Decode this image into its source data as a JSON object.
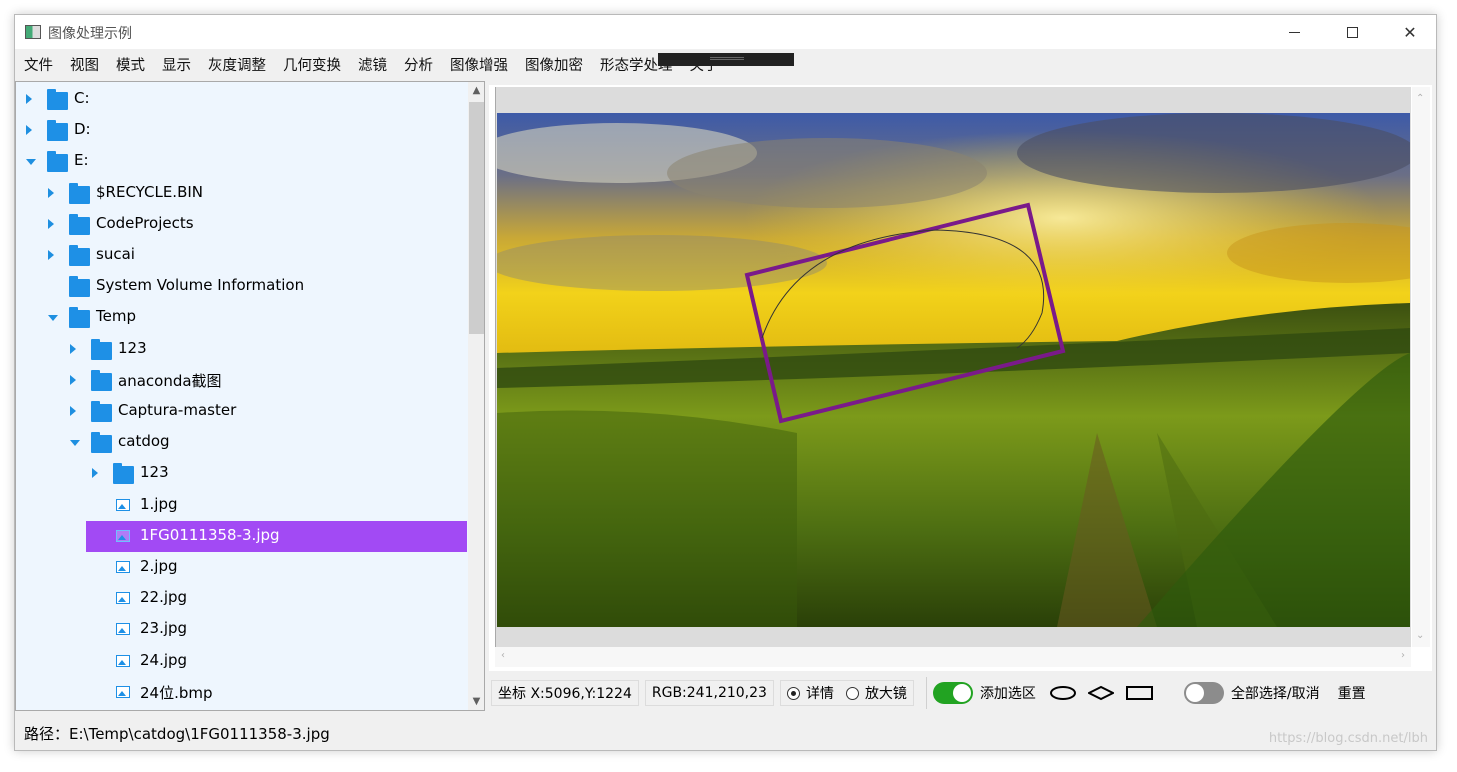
{
  "window": {
    "title": "图像处理示例",
    "controls": {
      "minimize": "—",
      "maximize": "☐",
      "close": "✕"
    }
  },
  "menu": {
    "items": [
      "文件",
      "视图",
      "模式",
      "显示",
      "灰度调整",
      "几何变换",
      "滤镜",
      "分析",
      "图像增强",
      "图像加密",
      "形态学处理",
      "关于"
    ]
  },
  "tree": {
    "rows": [
      {
        "label": "C:",
        "type": "folder",
        "expander": "collapsed"
      },
      {
        "label": "D:",
        "type": "folder",
        "expander": "collapsed"
      },
      {
        "label": "E:",
        "type": "folder",
        "expander": "expanded"
      },
      {
        "label": "$RECYCLE.BIN",
        "type": "folder",
        "expander": "collapsed"
      },
      {
        "label": "CodeProjects",
        "type": "folder",
        "expander": "collapsed"
      },
      {
        "label": "sucai",
        "type": "folder",
        "expander": "collapsed"
      },
      {
        "label": "System Volume Information",
        "type": "folder",
        "expander": "none"
      },
      {
        "label": "Temp",
        "type": "folder",
        "expander": "expanded"
      },
      {
        "label": "123",
        "type": "folder",
        "expander": "collapsed"
      },
      {
        "label": "anaconda截图",
        "type": "folder",
        "expander": "collapsed"
      },
      {
        "label": "Captura-master",
        "type": "folder",
        "expander": "collapsed"
      },
      {
        "label": "catdog",
        "type": "folder",
        "expander": "expanded"
      },
      {
        "label": "123",
        "type": "folder",
        "expander": "collapsed"
      },
      {
        "label": "1.jpg",
        "type": "image",
        "expander": "none"
      },
      {
        "label": "1FG0111358-3.jpg",
        "type": "image",
        "expander": "none",
        "selected": true
      },
      {
        "label": "2.jpg",
        "type": "image",
        "expander": "none"
      },
      {
        "label": "22.jpg",
        "type": "image",
        "expander": "none"
      },
      {
        "label": "23.jpg",
        "type": "image",
        "expander": "none"
      },
      {
        "label": "24.jpg",
        "type": "image",
        "expander": "none"
      },
      {
        "label": "24位.bmp",
        "type": "image",
        "expander": "none"
      }
    ]
  },
  "status": {
    "coords": "坐标 X:5096,Y:1224",
    "rgb": "RGB:241,210,23",
    "mode_detail": "详情",
    "mode_magnifier": "放大镜",
    "add_selection": "添加选区",
    "select_all": "全部选择/取消",
    "reset": "重置"
  },
  "path": {
    "text": "路径：E:\\Temp\\catdog\\1FG0111358-3.jpg"
  },
  "watermark": "https://blog.csdn.net/lbh",
  "colors": {
    "accent_selection": "#a24af4",
    "folder_blue": "#1e90e6",
    "toggle_on": "#22a322",
    "selection_rect": "#7a1a8a"
  }
}
